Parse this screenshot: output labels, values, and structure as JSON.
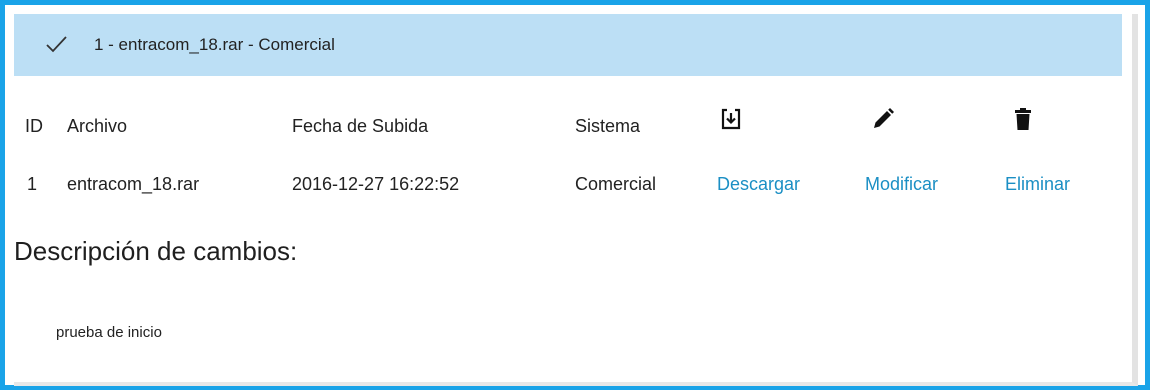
{
  "header": {
    "check_icon": "checkmark-icon",
    "title": "1 - entracom_18.rar - Comercial",
    "background": "#bcdff5"
  },
  "table": {
    "columns": [
      "ID",
      "Archivo",
      "Fecha de Subida",
      "Sistema"
    ],
    "action_icons": [
      "download-icon",
      "pencil-icon",
      "trash-icon"
    ],
    "rows": [
      {
        "id": "1",
        "archivo": "entracom_18.rar",
        "fecha": "2016-12-27 16:22:52",
        "sistema": "Comercial",
        "download_label": "Descargar",
        "modify_label": "Modificar",
        "delete_label": "Eliminar"
      }
    ]
  },
  "description": {
    "title": "Descripción de cambios:",
    "text": "prueba de inicio"
  },
  "colors": {
    "frame_border": "#1aa3e8",
    "link": "#1b8fc4"
  }
}
